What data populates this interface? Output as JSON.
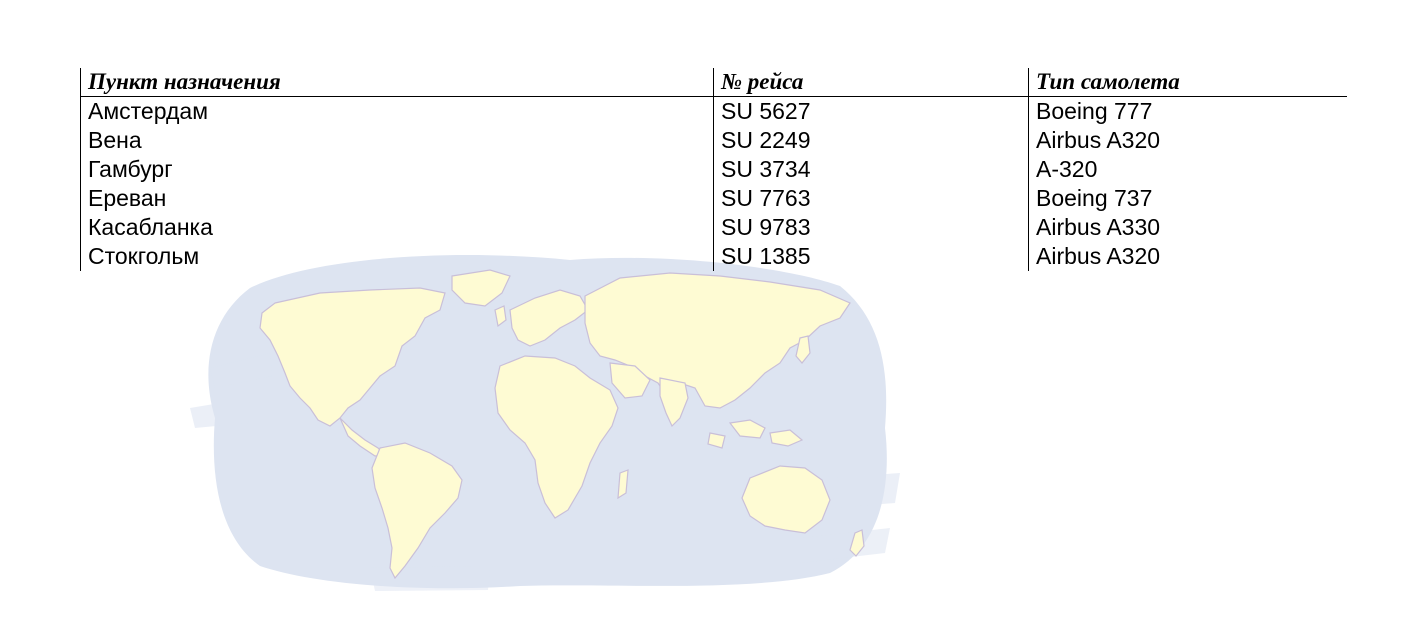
{
  "table": {
    "headers": {
      "destination": "Пункт назначения",
      "flight": "№ рейса",
      "aircraft": "Тип самолета"
    },
    "rows": [
      {
        "destination": "Амстердам",
        "flight": "SU 5627",
        "aircraft": "Boeing 777"
      },
      {
        "destination": "Вена",
        "flight": "SU 2249",
        "aircraft": "Airbus A320"
      },
      {
        "destination": "Гамбург",
        "flight": "SU 3734",
        "aircraft": "A-320"
      },
      {
        "destination": "Ереван",
        "flight": "SU 7763",
        "aircraft": "Boeing 737"
      },
      {
        "destination": "Касабланка",
        "flight": "SU 9783",
        "aircraft": "Airbus A330"
      },
      {
        "destination": "Стокгольм",
        "flight": "SU 1385",
        "aircraft": "Airbus A320"
      }
    ]
  },
  "map": {
    "icon": "world-map-icon",
    "ocean_color": "#dde4f1",
    "land_color": "#fefbd3",
    "coast_color": "#c9bfd8"
  }
}
